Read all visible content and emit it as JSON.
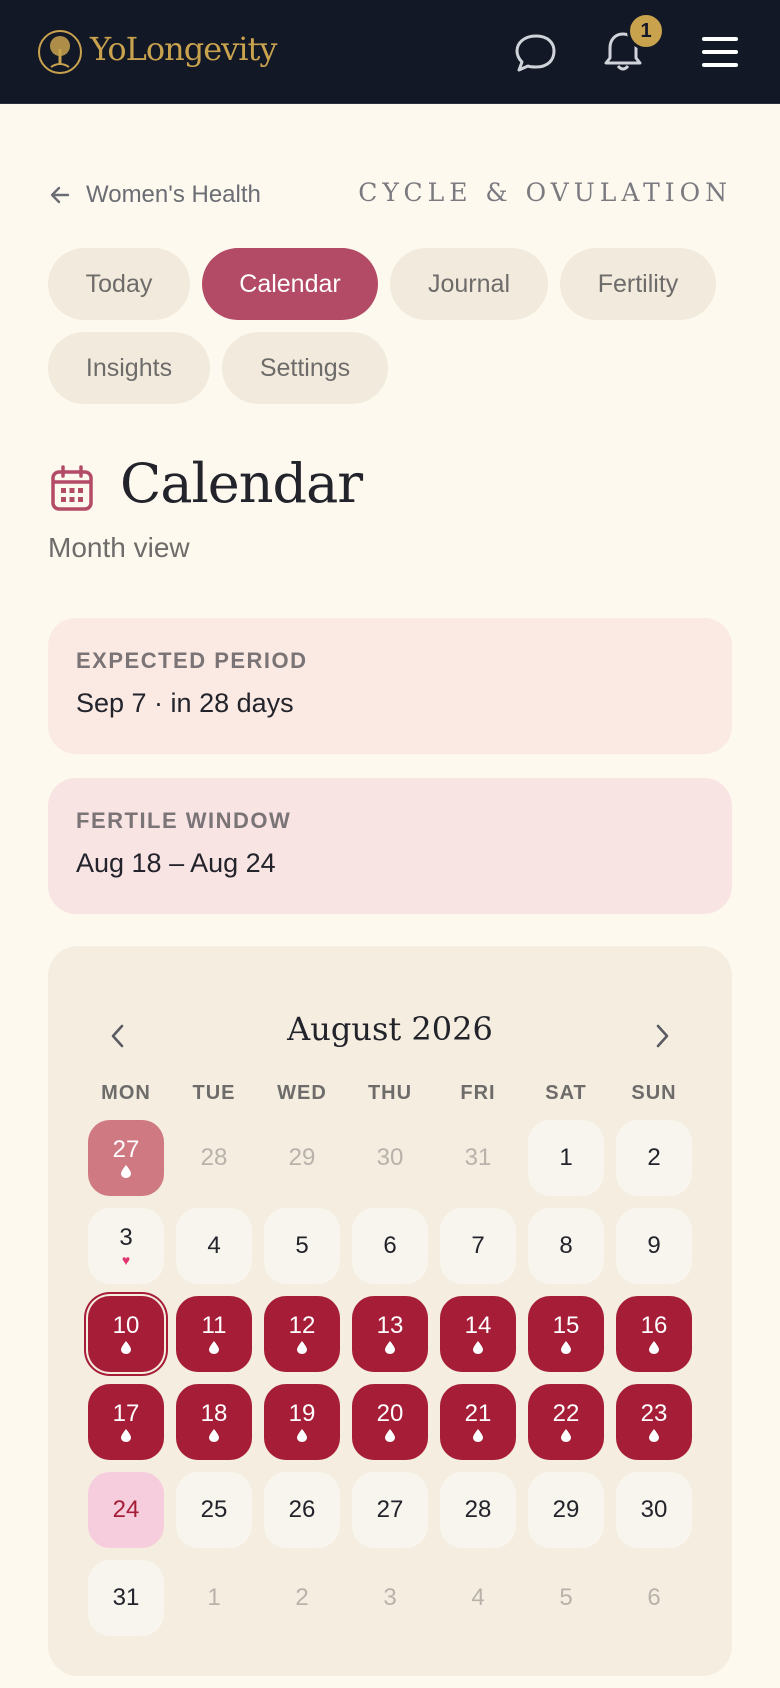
{
  "header": {
    "brand": "YoLongevity",
    "notification_count": "1",
    "colors": {
      "background": "#121826",
      "gold": "#c9a24e"
    },
    "icons": [
      "tree-logo-icon",
      "chat-bubble-icon",
      "bell-icon",
      "hamburger-menu-icon"
    ]
  },
  "breadcrumb": {
    "back_label": "Women's Health",
    "section": "CYCLE & OVULATION"
  },
  "tabs": [
    {
      "label": "Today",
      "active": false
    },
    {
      "label": "Calendar",
      "active": true
    },
    {
      "label": "Journal",
      "active": false
    },
    {
      "label": "Fertility",
      "active": false
    },
    {
      "label": "Insights",
      "active": false
    },
    {
      "label": "Settings",
      "active": false
    }
  ],
  "page": {
    "title": "Calendar",
    "subtitle": "Month view",
    "icon": "calendar-icon"
  },
  "cards": {
    "period": {
      "label": "EXPECTED PERIOD",
      "value": "Sep 7 · in 28 days"
    },
    "fertile": {
      "label": "FERTILE WINDOW",
      "value": "Aug 18 – Aug 24"
    }
  },
  "calendar": {
    "month_label": "August 2026",
    "weekdays": [
      "MON",
      "TUE",
      "WED",
      "THU",
      "FRI",
      "SAT",
      "SUN"
    ],
    "colors": {
      "period": "#a61d37",
      "past_period": "#cf7983",
      "fertile_end": "#f6cddd",
      "heart": "#e0356e",
      "active_tab": "#b34b66"
    },
    "days": [
      {
        "label": "27",
        "kind": "past-period",
        "mark": "drop"
      },
      {
        "label": "28",
        "kind": "outside",
        "mark": ""
      },
      {
        "label": "29",
        "kind": "outside",
        "mark": ""
      },
      {
        "label": "30",
        "kind": "outside",
        "mark": ""
      },
      {
        "label": "31",
        "kind": "outside",
        "mark": ""
      },
      {
        "label": "1",
        "kind": "cur",
        "mark": ""
      },
      {
        "label": "2",
        "kind": "cur",
        "mark": ""
      },
      {
        "label": "3",
        "kind": "cur",
        "mark": "heart"
      },
      {
        "label": "4",
        "kind": "cur",
        "mark": ""
      },
      {
        "label": "5",
        "kind": "cur",
        "mark": ""
      },
      {
        "label": "6",
        "kind": "cur",
        "mark": ""
      },
      {
        "label": "7",
        "kind": "cur",
        "mark": ""
      },
      {
        "label": "8",
        "kind": "cur",
        "mark": ""
      },
      {
        "label": "9",
        "kind": "cur",
        "mark": ""
      },
      {
        "label": "10",
        "kind": "period today",
        "mark": "drop"
      },
      {
        "label": "11",
        "kind": "period",
        "mark": "drop"
      },
      {
        "label": "12",
        "kind": "period",
        "mark": "drop"
      },
      {
        "label": "13",
        "kind": "period",
        "mark": "drop"
      },
      {
        "label": "14",
        "kind": "period",
        "mark": "drop"
      },
      {
        "label": "15",
        "kind": "period",
        "mark": "drop"
      },
      {
        "label": "16",
        "kind": "period",
        "mark": "drop"
      },
      {
        "label": "17",
        "kind": "period",
        "mark": "drop"
      },
      {
        "label": "18",
        "kind": "period",
        "mark": "drop"
      },
      {
        "label": "19",
        "kind": "period",
        "mark": "drop"
      },
      {
        "label": "20",
        "kind": "period",
        "mark": "drop"
      },
      {
        "label": "21",
        "kind": "period",
        "mark": "drop"
      },
      {
        "label": "22",
        "kind": "period",
        "mark": "drop"
      },
      {
        "label": "23",
        "kind": "period",
        "mark": "drop"
      },
      {
        "label": "24",
        "kind": "fertile-end",
        "mark": ""
      },
      {
        "label": "25",
        "kind": "cur",
        "mark": ""
      },
      {
        "label": "26",
        "kind": "cur",
        "mark": ""
      },
      {
        "label": "27",
        "kind": "cur",
        "mark": ""
      },
      {
        "label": "28",
        "kind": "cur",
        "mark": ""
      },
      {
        "label": "29",
        "kind": "cur",
        "mark": ""
      },
      {
        "label": "30",
        "kind": "cur",
        "mark": ""
      },
      {
        "label": "31",
        "kind": "cur",
        "mark": ""
      },
      {
        "label": "1",
        "kind": "outside",
        "mark": ""
      },
      {
        "label": "2",
        "kind": "outside",
        "mark": ""
      },
      {
        "label": "3",
        "kind": "outside",
        "mark": ""
      },
      {
        "label": "4",
        "kind": "outside",
        "mark": ""
      },
      {
        "label": "5",
        "kind": "outside",
        "mark": ""
      },
      {
        "label": "6",
        "kind": "outside",
        "mark": ""
      }
    ]
  }
}
